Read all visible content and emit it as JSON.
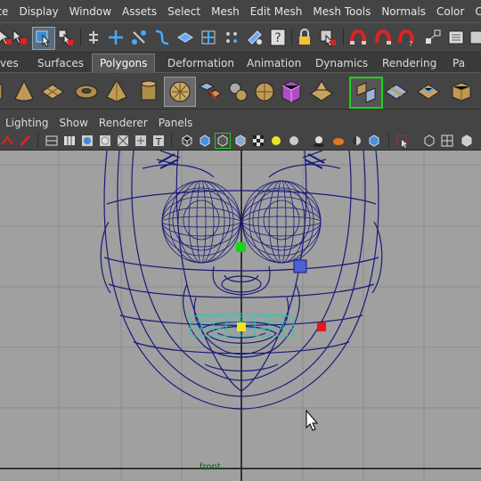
{
  "menubar": {
    "items": [
      "ate",
      "Display",
      "Window",
      "Assets",
      "Select",
      "Mesh",
      "Edit Mesh",
      "Mesh Tools",
      "Normals",
      "Color",
      "Create UVs"
    ]
  },
  "shelf_tabs": {
    "items": [
      "ves",
      "Surfaces",
      "Polygons",
      "Deformation",
      "Animation",
      "Dynamics",
      "Rendering",
      "Pa"
    ],
    "active": "Polygons"
  },
  "panel_menu": {
    "items": [
      "Lighting",
      "Show",
      "Renderer",
      "Panels"
    ]
  },
  "toolbar_icons": [
    "select-tool-icon",
    "lasso-icon",
    "paint-select-icon",
    "separator",
    "snap-grid-icon",
    "snap-curve-icon",
    "snap-point-icon",
    "snap-plane-icon",
    "snap-live-icon",
    "snap-surface-icon",
    "help-icon",
    "separator",
    "lock-icon",
    "selection-handle-icon",
    "construction-history-icon",
    "render-icon",
    "ipr-icon",
    "render-settings-icon"
  ],
  "shelf_icons": [
    "poly-sphere-icon",
    "poly-cone-icon",
    "poly-plane-icon",
    "poly-torus-icon",
    "poly-pyramid-icon",
    "poly-cylinder-icon",
    "poly-platonic-icon",
    "combine-icon",
    "separate-icon",
    "smooth-icon",
    "extract-icon",
    "bevel-icon",
    "mirror-icon",
    "bridge-icon",
    "append-icon",
    "extrude-icon"
  ],
  "viewport": {
    "camera_label": "front"
  },
  "colors": {
    "ui_bg": "#444444",
    "viewport_bg": "#a0a0a0",
    "wireframe": "#1a1a7a",
    "selected_wire": "#34c4b0",
    "manipulator_green": "#19d219",
    "manipulator_yellow": "#f2e31a",
    "manipulator_red": "#e8161a"
  }
}
